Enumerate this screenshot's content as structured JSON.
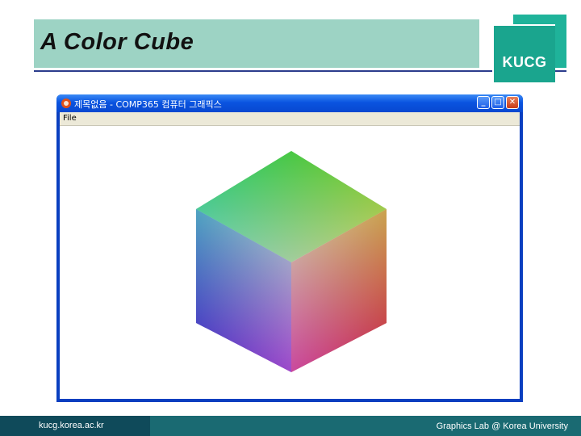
{
  "slide": {
    "title": "A Color Cube",
    "logo_text": "KUCG",
    "footer_left": "kucg.korea.ac.kr",
    "footer_right": "Graphics Lab @ Korea University"
  },
  "window": {
    "title": "제목없음 - COMP365 컴퓨터 그래픽스",
    "menu": [
      "File"
    ],
    "controls": {
      "minimize": "_",
      "maximize": "□",
      "close": "✕"
    }
  },
  "cube": {
    "faces": [
      "top",
      "left",
      "right"
    ],
    "corner_colors": {
      "top": "#1ec81e",
      "top_left": "#1ec8b4",
      "top_right": "#c8c81e",
      "bottom_left": "#1e1ec8",
      "bottom_right": "#c81e1e",
      "bottom": "#c81ec8",
      "center": "#d2d2d2"
    }
  }
}
